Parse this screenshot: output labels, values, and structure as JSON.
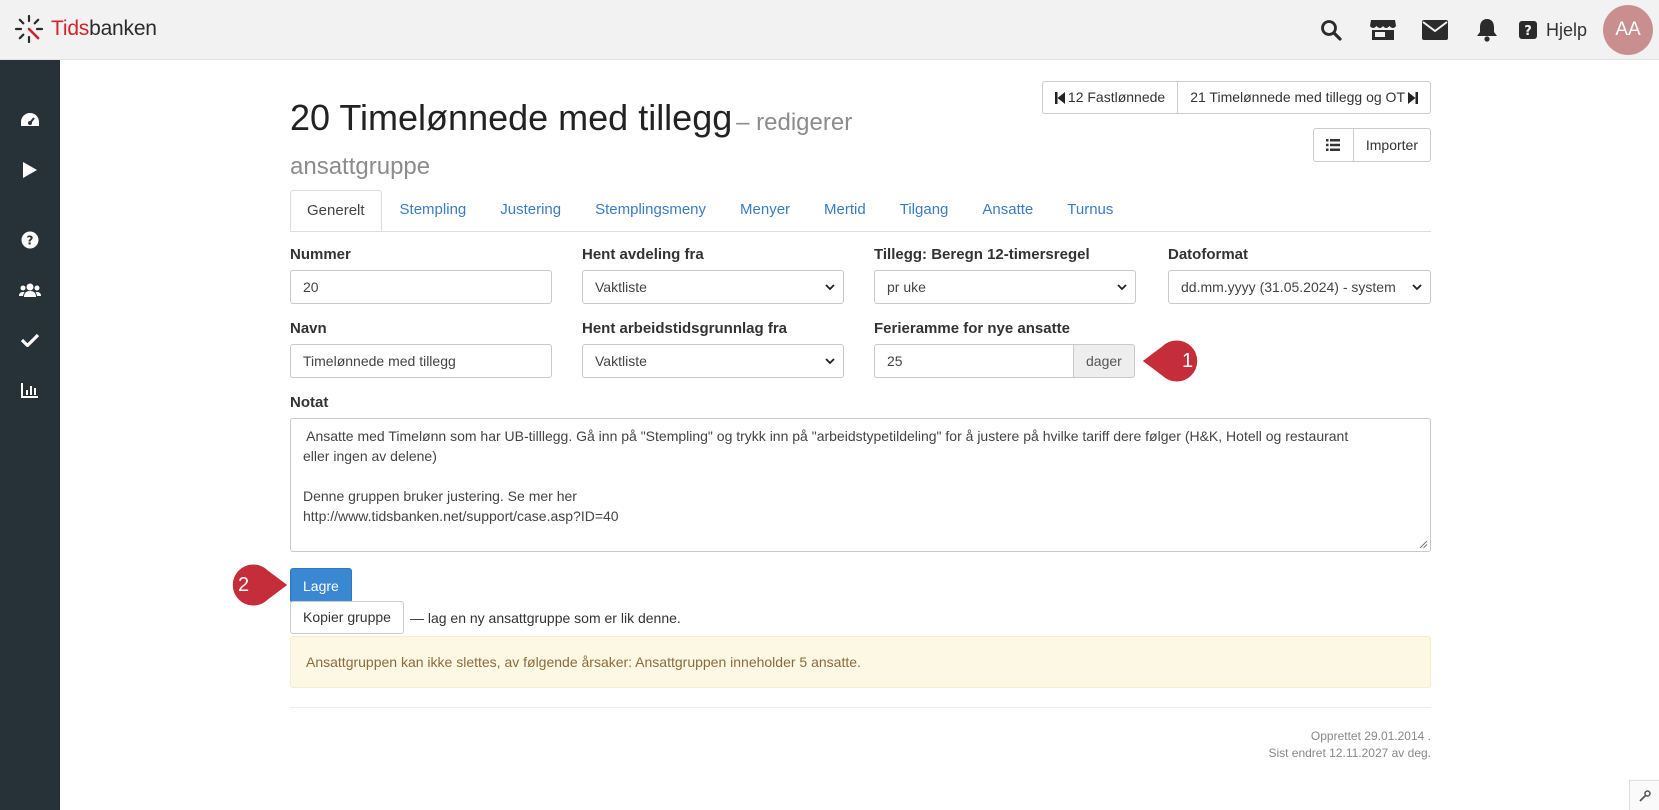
{
  "app": {
    "logo_brand_red": "Tids",
    "logo_brand_dark": "banken"
  },
  "topbar": {
    "icons": [
      "search-icon",
      "store-icon",
      "envelope-icon",
      "bell-icon",
      "question-square-icon"
    ],
    "help_label": "Hjelp",
    "avatar_initials": "AA",
    "avatar_color": "#c98f8f"
  },
  "sidebar": {
    "icons": [
      "dashboard-icon",
      "play-icon",
      "help-circle-icon",
      "users-icon",
      "check-icon",
      "bar-chart-icon"
    ],
    "background": "#263238"
  },
  "header": {
    "title": "20 Timelønnede med tillegg",
    "subtitle": "– redigerer ansattgruppe",
    "prev_button": "12 Fastlønnede",
    "next_button": "21 Timelønnede med tillegg og OT",
    "list_icon": "list-icon",
    "import_button": "Importer"
  },
  "tabs": [
    {
      "label": "Generelt",
      "active": true
    },
    {
      "label": "Stempling",
      "active": false
    },
    {
      "label": "Justering",
      "active": false
    },
    {
      "label": "Stemplingsmeny",
      "active": false
    },
    {
      "label": "Menyer",
      "active": false
    },
    {
      "label": "Mertid",
      "active": false
    },
    {
      "label": "Tilgang",
      "active": false
    },
    {
      "label": "Ansatte",
      "active": false
    },
    {
      "label": "Turnus",
      "active": false
    }
  ],
  "form": {
    "nummer": {
      "label": "Nummer",
      "value": "20"
    },
    "hent_avdeling": {
      "label": "Hent avdeling fra",
      "value": "Vaktliste"
    },
    "tillegg": {
      "label": "Tillegg: Beregn 12-timersregel",
      "value": "pr uke"
    },
    "datoformat": {
      "label": "Datoformat",
      "value": "dd.mm.yyyy (31.05.2024) - system"
    },
    "navn": {
      "label": "Navn",
      "value": "Timelønnede med tillegg"
    },
    "hent_arbeidstid": {
      "label": "Hent arbeidstidsgrunnlag fra",
      "value": "Vaktliste"
    },
    "ferieramme": {
      "label": "Ferieramme for nye ansatte",
      "value": "25",
      "addon": "dager"
    },
    "notat": {
      "label": "Notat",
      "lines": [
        " Ansatte med Timelønn som har UB-tilllegg. Gå inn på \"Stempling\" og trykk inn på \"arbeidstypetildeling\" for å justere på hvilke tariff dere følger (H&K, Hotell og restaurant",
        "eller ingen av delene)",
        "",
        "Denne gruppen bruker justering. Se mer her",
        "http://www.tidsbanken.net/support/case.asp?ID=40"
      ]
    }
  },
  "actions": {
    "save_button": "Lagre",
    "copy_button": "Kopier gruppe",
    "copy_description": "— lag en ny ansattgruppe som er lik denne."
  },
  "alert": {
    "text": "Ansattgruppen kan ikke slettes, av følgende årsaker: Ansattgruppen inneholder 5 ansatte."
  },
  "meta": {
    "created": "Opprettet 29.01.2014 .",
    "modified": "Sist endret 12.11.2027 av deg."
  },
  "callouts": {
    "one": "1",
    "two": "2",
    "color": "#c62d3a"
  },
  "colors": {
    "accent": "#3a87d2",
    "link": "#3a7cc4",
    "brand_red": "#d0232a"
  }
}
